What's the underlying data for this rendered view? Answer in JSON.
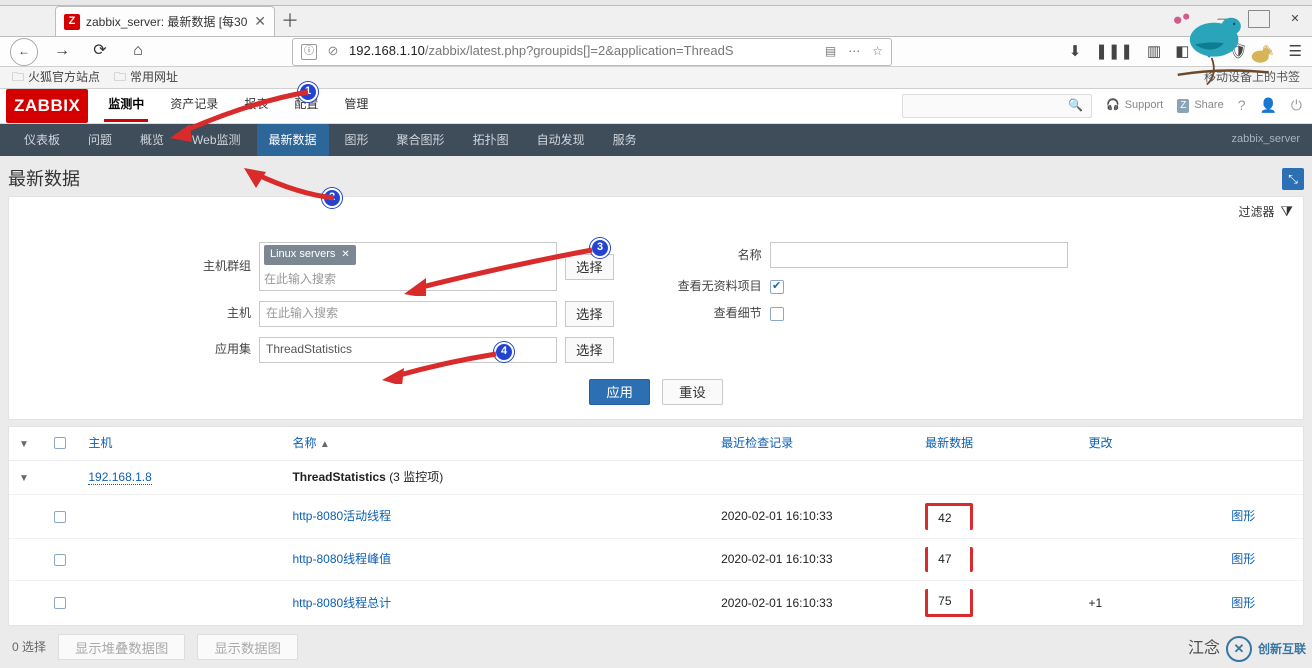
{
  "browser": {
    "tab_title": "zabbix_server: 最新数据 [每30",
    "url_host": "192.168.1.10",
    "url_path": "/zabbix/latest.php?groupids[]=2&application=ThreadS",
    "bookmarks": [
      "火狐官方站点",
      "常用网址"
    ],
    "mobile_bookmarks": "移动设备上的书签"
  },
  "header": {
    "logo": "ZABBIX",
    "topmenu": [
      "监测中",
      "资产记录",
      "报表",
      "配置",
      "管理"
    ],
    "topmenu_active_index": 0,
    "support": "Support",
    "share": "Share",
    "server": "zabbix_server",
    "subnav": [
      "仪表板",
      "问题",
      "概览",
      "Web监测",
      "最新数据",
      "图形",
      "聚合图形",
      "拓扑图",
      "自动发现",
      "服务"
    ],
    "subnav_active_index": 4
  },
  "page": {
    "title": "最新数据",
    "filter_toggle": "过滤器"
  },
  "filter": {
    "labels": {
      "hostgroup": "主机群组",
      "host": "主机",
      "application": "应用集",
      "name": "名称",
      "show_without_data": "查看无资料项目",
      "show_details": "查看细节"
    },
    "hostgroup_tag": "Linux servers",
    "hostgroup_placeholder": "在此输入搜索",
    "host_placeholder": "在此输入搜索",
    "application_value": "ThreadStatistics",
    "select_btn": "选择",
    "show_without_data_checked": true,
    "show_details_checked": false,
    "apply": "应用",
    "reset": "重设"
  },
  "table": {
    "columns": {
      "host": "主机",
      "name": "名称",
      "last_check": "最近检查记录",
      "last_value": "最新数据",
      "change": "更改",
      "graph": "图形"
    },
    "sort_col": "name",
    "group_row": {
      "host": "192.168.1.8",
      "app": "ThreadStatistics",
      "count_label": "(3 监控项)"
    },
    "rows": [
      {
        "name": "http-8080活动线程",
        "ts": "2020-02-01 16:10:33",
        "val": "42",
        "change": "",
        "graph": "图形"
      },
      {
        "name": "http-8080线程峰值",
        "ts": "2020-02-01 16:10:33",
        "val": "47",
        "change": "",
        "graph": "图形"
      },
      {
        "name": "http-8080线程总计",
        "ts": "2020-02-01 16:10:33",
        "val": "75",
        "change": "+1",
        "graph": "图形"
      }
    ],
    "footer": {
      "selected": "0 选择",
      "stacked": "显示堆叠数据图",
      "plain": "显示数据图"
    }
  },
  "chart_data": {
    "type": "table",
    "title": "ThreadStatistics (3 监控项) — 192.168.1.8",
    "columns": [
      "名称",
      "最近检查记录",
      "最新数据",
      "更改"
    ],
    "rows": [
      [
        "http-8080活动线程",
        "2020-02-01 16:10:33",
        42,
        null
      ],
      [
        "http-8080线程峰值",
        "2020-02-01 16:10:33",
        47,
        null
      ],
      [
        "http-8080线程总计",
        "2020-02-01 16:10:33",
        75,
        1
      ]
    ]
  },
  "annotations": [
    "1",
    "2",
    "3",
    "4"
  ],
  "watermark": {
    "brand": "创新互联",
    "sub": "江念"
  }
}
